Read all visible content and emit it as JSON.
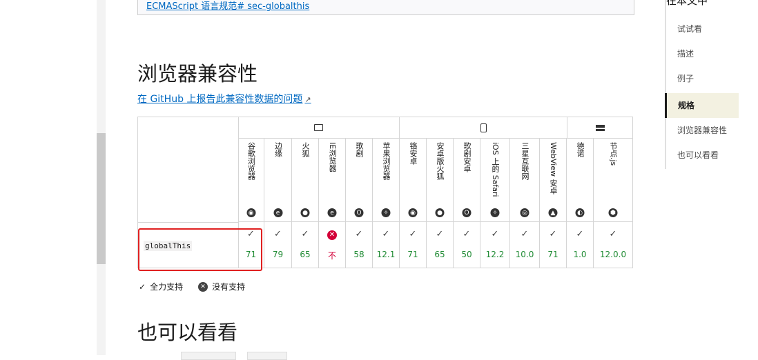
{
  "spec_link": "ECMAScript 语言规范# sec-globalthis",
  "compat_heading": "浏览器兼容性",
  "report_link": "在 GitHub 上报告此兼容性数据的问题",
  "platform_icons": [
    "desktop-icon",
    "mobile-icon",
    "server-icon"
  ],
  "browsers": [
    {
      "name": "谷歌浏览器",
      "icon": "chrome-icon"
    },
    {
      "name": "边缘",
      "icon": "edge-icon"
    },
    {
      "name": "火狐",
      "icon": "firefox-icon"
    },
    {
      "name": "IE浏览器",
      "icon": "ie-icon"
    },
    {
      "name": "歌剧",
      "icon": "opera-icon"
    },
    {
      "name": "苹果浏览器",
      "icon": "safari-icon"
    },
    {
      "name": "铬安卓",
      "icon": "chrome-icon"
    },
    {
      "name": "安卓版火狐",
      "icon": "firefox-icon"
    },
    {
      "name": "歌剧安卓",
      "icon": "opera-icon"
    },
    {
      "name": "iOS 上的 Safari",
      "icon": "safari-icon"
    },
    {
      "name": "三星互联网",
      "icon": "samsung-icon"
    },
    {
      "name": "WebView 安卓",
      "icon": "android-icon"
    },
    {
      "name": "德诺",
      "icon": "deno-icon"
    },
    {
      "name": "节点.js",
      "icon": "nodejs-icon"
    }
  ],
  "feature": "globalThis",
  "support": [
    {
      "mark": "✓",
      "version": "71"
    },
    {
      "mark": "✓",
      "version": "79"
    },
    {
      "mark": "✓",
      "version": "65"
    },
    {
      "mark": "✕",
      "version": "不"
    },
    {
      "mark": "✓",
      "version": "58"
    },
    {
      "mark": "✓",
      "version": "12.1"
    },
    {
      "mark": "✓",
      "version": "71"
    },
    {
      "mark": "✓",
      "version": "65"
    },
    {
      "mark": "✓",
      "version": "50"
    },
    {
      "mark": "✓",
      "version": "12.2"
    },
    {
      "mark": "✓",
      "version": "10.0"
    },
    {
      "mark": "✓",
      "version": "71"
    },
    {
      "mark": "✓",
      "version": "1.0"
    },
    {
      "mark": "✓",
      "version": "12.0.0"
    }
  ],
  "legend": {
    "full": "全力支持",
    "none": "没有支持"
  },
  "see_also_heading": "也可以看看",
  "sidebar": {
    "title": "在本文中",
    "items": [
      "试试看",
      "描述",
      "例子",
      "规格",
      "浏览器兼容性",
      "也可以看看"
    ],
    "active_index": 3
  },
  "colors": {
    "link": "#0069c2",
    "yes": "#1e8a32",
    "no": "#d30038",
    "highlight": "#e02020"
  }
}
